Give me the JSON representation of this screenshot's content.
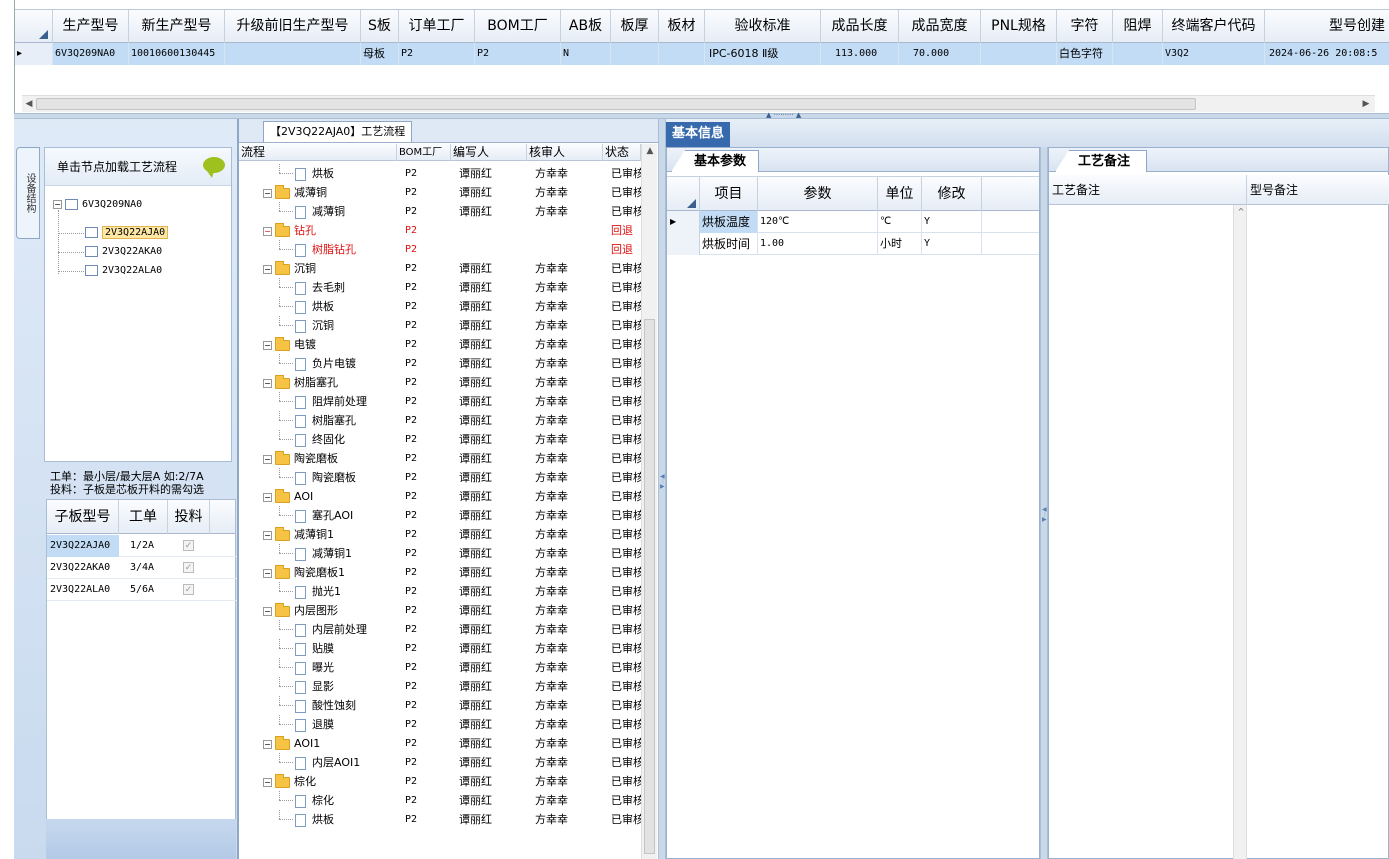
{
  "top_grid": {
    "columns": [
      "生产型号",
      "新生产型号",
      "升级前旧生产型号",
      "S板",
      "订单工厂",
      "BOM工厂",
      "AB板",
      "板厚",
      "板材",
      "验收标准",
      "成品长度",
      "成品宽度",
      "PNL规格",
      "字符",
      "阻焊",
      "终端客户代码",
      "型号创建"
    ],
    "row": {
      "marker": "▸",
      "cells": [
        "6V3Q209NA0",
        "10010600130445",
        "",
        "母板",
        "P2",
        "P2",
        "N",
        "",
        "",
        "IPC-6018 Ⅱ级",
        "113.000",
        "70.000",
        "",
        "白色字符",
        "",
        "V3Q2",
        "2024-06-26 20:08:5"
      ]
    }
  },
  "left_panel": {
    "side_tab_label": "设备结构",
    "tree_header": "单击节点加载工艺流程",
    "tree": {
      "root": "6V3Q209NA0",
      "children": [
        "2V3Q22AJA0",
        "2V3Q22AKA0",
        "2V3Q22ALA0"
      ],
      "selected_index": 0
    },
    "note_line1": "工单：最小层/最大层A 如:2/7A",
    "note_line2": "投料：子板是芯板开料的需勾选",
    "sub_grid": {
      "columns": [
        "子板型号",
        "工单",
        "投料"
      ],
      "rows": [
        {
          "model": "2V3Q22AJA0",
          "order": "1/2A",
          "feed": "✓"
        },
        {
          "model": "2V3Q22AKA0",
          "order": "3/4A",
          "feed": "✓"
        },
        {
          "model": "2V3Q22ALA0",
          "order": "5/6A",
          "feed": "✓"
        }
      ]
    }
  },
  "process": {
    "tab_label": "【2V3Q22AJA0】工艺流程",
    "columns": [
      "流程",
      "BOM工厂",
      "编写人",
      "核审人",
      "状态"
    ],
    "rows": [
      {
        "level": 1,
        "name": "烘板",
        "factory": "P2",
        "writer": "谭丽红",
        "reviewer": "方幸幸",
        "status": "已审核",
        "red": false
      },
      {
        "level": 0,
        "name": "减薄铜",
        "factory": "P2",
        "writer": "谭丽红",
        "reviewer": "方幸幸",
        "status": "已审核",
        "red": false
      },
      {
        "level": 1,
        "name": "减薄铜",
        "factory": "P2",
        "writer": "谭丽红",
        "reviewer": "方幸幸",
        "status": "已审核",
        "red": false
      },
      {
        "level": 0,
        "name": "钻孔",
        "factory": "P2",
        "writer": "",
        "reviewer": "",
        "status": "回退",
        "red": true
      },
      {
        "level": 1,
        "name": "树脂钻孔",
        "factory": "P2",
        "writer": "",
        "reviewer": "",
        "status": "回退",
        "red": true
      },
      {
        "level": 0,
        "name": "沉铜",
        "factory": "P2",
        "writer": "谭丽红",
        "reviewer": "方幸幸",
        "status": "已审核",
        "red": false
      },
      {
        "level": 1,
        "name": "去毛刺",
        "factory": "P2",
        "writer": "谭丽红",
        "reviewer": "方幸幸",
        "status": "已审核",
        "red": false
      },
      {
        "level": 1,
        "name": "烘板",
        "factory": "P2",
        "writer": "谭丽红",
        "reviewer": "方幸幸",
        "status": "已审核",
        "red": false
      },
      {
        "level": 1,
        "name": "沉铜",
        "factory": "P2",
        "writer": "谭丽红",
        "reviewer": "方幸幸",
        "status": "已审核",
        "red": false
      },
      {
        "level": 0,
        "name": "电镀",
        "factory": "P2",
        "writer": "谭丽红",
        "reviewer": "方幸幸",
        "status": "已审核",
        "red": false
      },
      {
        "level": 1,
        "name": "负片电镀",
        "factory": "P2",
        "writer": "谭丽红",
        "reviewer": "方幸幸",
        "status": "已审核",
        "red": false
      },
      {
        "level": 0,
        "name": "树脂塞孔",
        "factory": "P2",
        "writer": "谭丽红",
        "reviewer": "方幸幸",
        "status": "已审核",
        "red": false
      },
      {
        "level": 1,
        "name": "阻焊前处理",
        "factory": "P2",
        "writer": "谭丽红",
        "reviewer": "方幸幸",
        "status": "已审核",
        "red": false
      },
      {
        "level": 1,
        "name": "树脂塞孔",
        "factory": "P2",
        "writer": "谭丽红",
        "reviewer": "方幸幸",
        "status": "已审核",
        "red": false
      },
      {
        "level": 1,
        "name": "终固化",
        "factory": "P2",
        "writer": "谭丽红",
        "reviewer": "方幸幸",
        "status": "已审核",
        "red": false
      },
      {
        "level": 0,
        "name": "陶瓷磨板",
        "factory": "P2",
        "writer": "谭丽红",
        "reviewer": "方幸幸",
        "status": "已审核",
        "red": false
      },
      {
        "level": 1,
        "name": "陶瓷磨板",
        "factory": "P2",
        "writer": "谭丽红",
        "reviewer": "方幸幸",
        "status": "已审核",
        "red": false
      },
      {
        "level": 0,
        "name": "AOI",
        "factory": "P2",
        "writer": "谭丽红",
        "reviewer": "方幸幸",
        "status": "已审核",
        "red": false
      },
      {
        "level": 1,
        "name": "塞孔AOI",
        "factory": "P2",
        "writer": "谭丽红",
        "reviewer": "方幸幸",
        "status": "已审核",
        "red": false
      },
      {
        "level": 0,
        "name": "减薄铜1",
        "factory": "P2",
        "writer": "谭丽红",
        "reviewer": "方幸幸",
        "status": "已审核",
        "red": false
      },
      {
        "level": 1,
        "name": "减薄铜1",
        "factory": "P2",
        "writer": "谭丽红",
        "reviewer": "方幸幸",
        "status": "已审核",
        "red": false
      },
      {
        "level": 0,
        "name": "陶瓷磨板1",
        "factory": "P2",
        "writer": "谭丽红",
        "reviewer": "方幸幸",
        "status": "已审核",
        "red": false
      },
      {
        "level": 1,
        "name": "抛光1",
        "factory": "P2",
        "writer": "谭丽红",
        "reviewer": "方幸幸",
        "status": "已审核",
        "red": false
      },
      {
        "level": 0,
        "name": "内层图形",
        "factory": "P2",
        "writer": "谭丽红",
        "reviewer": "方幸幸",
        "status": "已审核",
        "red": false
      },
      {
        "level": 1,
        "name": "内层前处理",
        "factory": "P2",
        "writer": "谭丽红",
        "reviewer": "方幸幸",
        "status": "已审核",
        "red": false
      },
      {
        "level": 1,
        "name": "贴膜",
        "factory": "P2",
        "writer": "谭丽红",
        "reviewer": "方幸幸",
        "status": "已审核",
        "red": false
      },
      {
        "level": 1,
        "name": "曝光",
        "factory": "P2",
        "writer": "谭丽红",
        "reviewer": "方幸幸",
        "status": "已审核",
        "red": false
      },
      {
        "level": 1,
        "name": "显影",
        "factory": "P2",
        "writer": "谭丽红",
        "reviewer": "方幸幸",
        "status": "已审核",
        "red": false
      },
      {
        "level": 1,
        "name": "酸性蚀刻",
        "factory": "P2",
        "writer": "谭丽红",
        "reviewer": "方幸幸",
        "status": "已审核",
        "red": false
      },
      {
        "level": 1,
        "name": "退膜",
        "factory": "P2",
        "writer": "谭丽红",
        "reviewer": "方幸幸",
        "status": "已审核",
        "red": false
      },
      {
        "level": 0,
        "name": "AOI1",
        "factory": "P2",
        "writer": "谭丽红",
        "reviewer": "方幸幸",
        "status": "已审核",
        "red": false
      },
      {
        "level": 1,
        "name": "内层AOI1",
        "factory": "P2",
        "writer": "谭丽红",
        "reviewer": "方幸幸",
        "status": "已审核",
        "red": false
      },
      {
        "level": 0,
        "name": "棕化",
        "factory": "P2",
        "writer": "谭丽红",
        "reviewer": "方幸幸",
        "status": "已审核",
        "red": false
      },
      {
        "level": 1,
        "name": "棕化",
        "factory": "P2",
        "writer": "谭丽红",
        "reviewer": "方幸幸",
        "status": "已审核",
        "red": false
      },
      {
        "level": 1,
        "name": "烘板",
        "factory": "P2",
        "writer": "谭丽红",
        "reviewer": "方幸幸",
        "status": "已审核",
        "red": false
      }
    ]
  },
  "right": {
    "tab_basic": "基本信息",
    "params_tab": "基本参数",
    "params_columns": [
      "项目",
      "参数",
      "单位",
      "修改"
    ],
    "params_rows": [
      {
        "item": "烘板温度",
        "value": "120℃",
        "unit": "℃",
        "edit": "Y"
      },
      {
        "item": "烘板时间",
        "value": "1.00",
        "unit": "小时",
        "edit": "Y"
      }
    ],
    "notes_tab": "工艺备注",
    "notes_columns": [
      "工艺备注",
      "型号备注"
    ]
  },
  "colors": {
    "selected_row": "#c2dcf6",
    "tab_active": "#3769ad",
    "status_red": "#dd1111",
    "folder": "#f6c344"
  }
}
